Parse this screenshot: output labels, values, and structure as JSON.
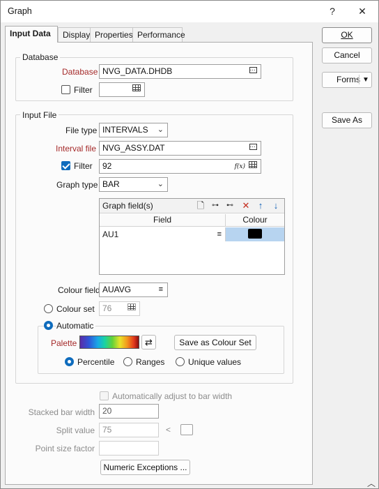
{
  "window": {
    "title": "Graph",
    "help_glyph": "?",
    "close_glyph": "✕"
  },
  "tabs": [
    {
      "label": "Input Data",
      "active": true
    },
    {
      "label": "Display"
    },
    {
      "label": "Properties"
    },
    {
      "label": "Performance"
    }
  ],
  "side_buttons": {
    "ok": "OK",
    "cancel": "Cancel",
    "forms": "Forms",
    "save_as": "Save As"
  },
  "database": {
    "group_label": "Database",
    "database_label": "Database",
    "database_value": "NVG_DATA.DHDB",
    "filter_label": "Filter",
    "filter_checked": false,
    "filter_value": ""
  },
  "input_file": {
    "group_label": "Input File",
    "file_type_label": "File type",
    "file_type_value": "INTERVALS",
    "interval_file_label": "Interval file",
    "interval_file_value": "NVG_ASSY.DAT",
    "filter_label": "Filter",
    "filter_checked": true,
    "filter_value": "92",
    "fx_glyph": "f(x)",
    "graph_type_label": "Graph type",
    "graph_type_value": "BAR",
    "graph_fields": {
      "title": "Graph field(s)",
      "columns": [
        "Field",
        "Colour"
      ],
      "rows": [
        {
          "field": "AU1",
          "colour": "#000000"
        }
      ]
    },
    "colour_field_label": "Colour field",
    "colour_field_value": "AUAVG",
    "colour_set_label": "Colour set",
    "colour_set_value": "76",
    "automatic_label": "Automatic",
    "palette_label": "Palette",
    "save_colour_set": "Save as Colour Set",
    "modes": [
      "Percentile",
      "Ranges",
      "Unique values"
    ],
    "selected_mode": "Percentile"
  },
  "bar_options": {
    "auto_adjust_label": "Automatically adjust to bar width",
    "stacked_bar_width_label": "Stacked bar width",
    "stacked_bar_width_value": "20",
    "split_value_label": "Split value",
    "split_value_value": "75",
    "split_compare": "<",
    "point_size_label": "Point size factor",
    "point_size_value": "",
    "numeric_exceptions": "Numeric Exceptions ..."
  }
}
